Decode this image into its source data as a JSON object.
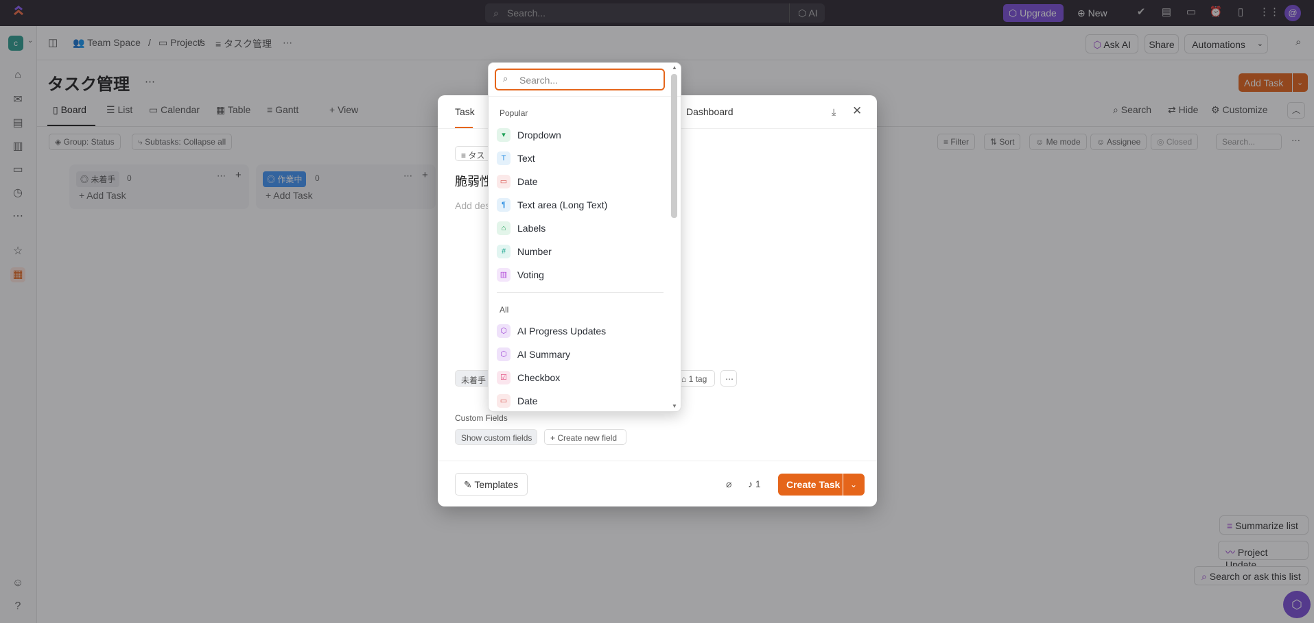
{
  "topbar": {
    "search_placeholder": "Search...",
    "ai_label": "AI",
    "upgrade_label": "Upgrade",
    "new_label": "New",
    "avatar_initial": "@"
  },
  "breadcrumb": {
    "space_initial": "c",
    "team_space": "Team Space",
    "separator": "/",
    "projects": "Projects",
    "list_name": "タスク管理"
  },
  "header_actions": {
    "ask_ai": "Ask AI",
    "share": "Share",
    "automations": "Automations"
  },
  "page": {
    "title": "タスク管理",
    "add_task": "Add Task"
  },
  "view_tabs": [
    {
      "label": "Board",
      "active": true
    },
    {
      "label": "List"
    },
    {
      "label": "Calendar"
    },
    {
      "label": "Table"
    },
    {
      "label": "Gantt"
    },
    {
      "label": "View"
    }
  ],
  "view_actions": {
    "search": "Search",
    "hide": "Hide",
    "customize": "Customize"
  },
  "filters": {
    "group": "Group: Status",
    "subtasks": "Subtasks: Collapse all",
    "filter": "Filter",
    "sort": "Sort",
    "me_mode": "Me mode",
    "assignee": "Assignee",
    "closed": "Closed",
    "search_placeholder": "Search..."
  },
  "board": {
    "columns": [
      {
        "name": "未着手",
        "count": "0",
        "add": "Add Task",
        "color": "#87909e"
      },
      {
        "name": "作業中",
        "count": "0",
        "add": "Add Task",
        "color": "#4194f6"
      }
    ]
  },
  "right_actions": {
    "summarize": "Summarize list",
    "project_update": "Project Update",
    "search_ask": "Search or ask this list"
  },
  "modal": {
    "tab_task": "Task",
    "tab_dashboard": "Dashboard",
    "list_chip": "タス",
    "task_name_partial": "脆弱性",
    "desc_partial": "Add des",
    "status_chip": "未着手",
    "tags": "1 tag",
    "custom_fields_label": "Custom Fields",
    "show_custom_fields": "Show custom fields",
    "create_new_field": "Create new field",
    "templates": "Templates",
    "notify_count": "1",
    "create_task": "Create Task"
  },
  "field_dropdown": {
    "search_placeholder": "Search...",
    "popular_label": "Popular",
    "all_label": "All",
    "popular": [
      {
        "label": "Dropdown",
        "icon": "dropdown-icon",
        "color": "#1a9f54",
        "bg": "#e3f5ea"
      },
      {
        "label": "Text",
        "icon": "text-icon",
        "color": "#2d8fe3",
        "bg": "#e4f1fb"
      },
      {
        "label": "Date",
        "icon": "calendar-icon",
        "color": "#d9534f",
        "bg": "#fbe9e9"
      },
      {
        "label": "Text area (Long Text)",
        "icon": "textarea-icon",
        "color": "#2d8fe3",
        "bg": "#e4f1fb"
      },
      {
        "label": "Labels",
        "icon": "tag-icon",
        "color": "#1a9f54",
        "bg": "#e3f5ea"
      },
      {
        "label": "Number",
        "icon": "hash-icon",
        "color": "#14a38b",
        "bg": "#e2f5f1"
      },
      {
        "label": "Voting",
        "icon": "voting-icon",
        "color": "#b14ad8",
        "bg": "#f4e6fb"
      }
    ],
    "all": [
      {
        "label": "AI Progress Updates",
        "icon": "ai-icon",
        "color": "#9b3fd3",
        "bg": "#efe2fa"
      },
      {
        "label": "AI Summary",
        "icon": "ai-icon",
        "color": "#9b3fd3",
        "bg": "#efe2fa"
      },
      {
        "label": "Checkbox",
        "icon": "checkbox-icon",
        "color": "#e0447a",
        "bg": "#fbe6ee"
      },
      {
        "label": "Date",
        "icon": "calendar-icon",
        "color": "#d9534f",
        "bg": "#fbe9e9"
      }
    ]
  }
}
